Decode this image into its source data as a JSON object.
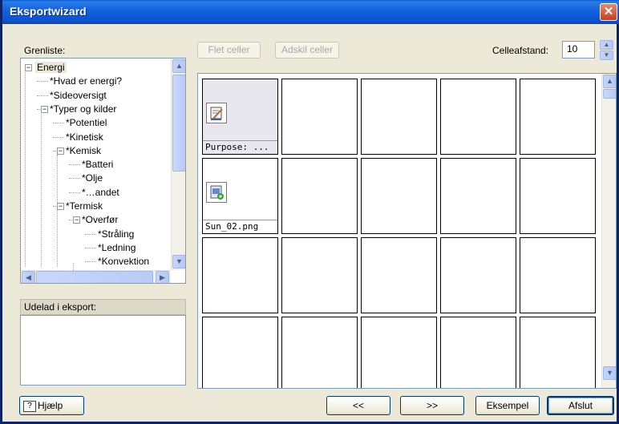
{
  "window": {
    "title": "Eksportwizard"
  },
  "tree": {
    "label": "Grenliste:",
    "nodes": [
      {
        "text": "Energi",
        "level": 0,
        "toggle": "−",
        "selected": true
      },
      {
        "text": "*Hvad er energi?",
        "level": 1
      },
      {
        "text": "*Sideoversigt",
        "level": 1
      },
      {
        "text": "*Typer og kilder",
        "level": 1,
        "toggle": "−"
      },
      {
        "text": "*Potentiel",
        "level": 2
      },
      {
        "text": "*Kinetisk",
        "level": 2
      },
      {
        "text": "*Kemisk",
        "level": 2,
        "toggle": "−"
      },
      {
        "text": "*Batteri",
        "level": 3
      },
      {
        "text": "*Olje",
        "level": 3
      },
      {
        "text": "*…andet",
        "level": 3
      },
      {
        "text": "*Termisk",
        "level": 2,
        "toggle": "−"
      },
      {
        "text": "*Overfør",
        "level": 3,
        "toggle": "−"
      },
      {
        "text": "*Stråling",
        "level": 4
      },
      {
        "text": "*Ledning",
        "level": 4
      },
      {
        "text": "*Konvektion",
        "level": 4
      }
    ]
  },
  "udelad": {
    "label": "Udelad i eksport:"
  },
  "toolbar": {
    "merge_label": "Flet celler",
    "split_label": "Adskil celler",
    "spacing_label": "Celleafstand:",
    "spacing_value": "10"
  },
  "grid": {
    "columns": 5,
    "rows": 4,
    "filled": [
      {
        "row": 0,
        "col": 0,
        "caption": "Purpose: ...",
        "icon": "note-pencil-icon"
      },
      {
        "row": 1,
        "col": 0,
        "caption": "Sun_02.png",
        "icon": "image-file-icon"
      }
    ]
  },
  "footer": {
    "help_label": "Hjælp",
    "back_label": "<<",
    "next_label": ">>",
    "example_label": "Eksempel",
    "finish_label": "Afslut"
  }
}
